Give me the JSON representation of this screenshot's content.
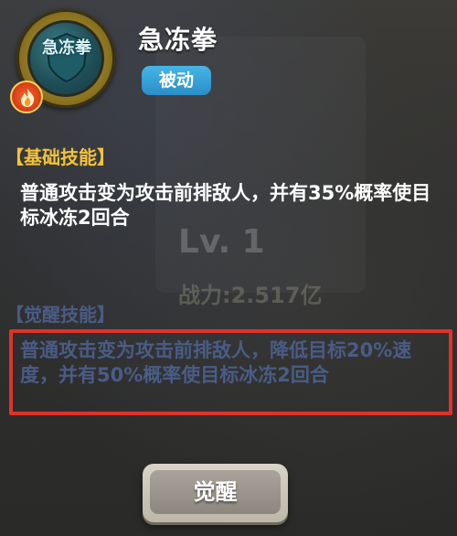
{
  "skill": {
    "name": "急冻拳",
    "icon_text": "急冻拳",
    "icon": "frozen-fist-skill-icon",
    "type_badge": "被动"
  },
  "background": {
    "level_text": "Lv. 1",
    "power_text": "战力:2.517亿"
  },
  "base_skill": {
    "title": "【基础技能】",
    "description": "普通攻击变为攻击前排敌人，并有35%概率使目标冰冻2回合"
  },
  "awakened_skill": {
    "title": "【觉醒技能】",
    "description": "普通攻击变为攻击前排敌人，降低目标20%速度，并有50%概率使目标冰冻2回合"
  },
  "awaken_button": {
    "label": "觉醒"
  },
  "colors": {
    "base_title": "#f2c23a",
    "awakened_text": "#4a5c86",
    "type_badge": "#3aa6dc",
    "highlight_border": "#e0322a"
  }
}
